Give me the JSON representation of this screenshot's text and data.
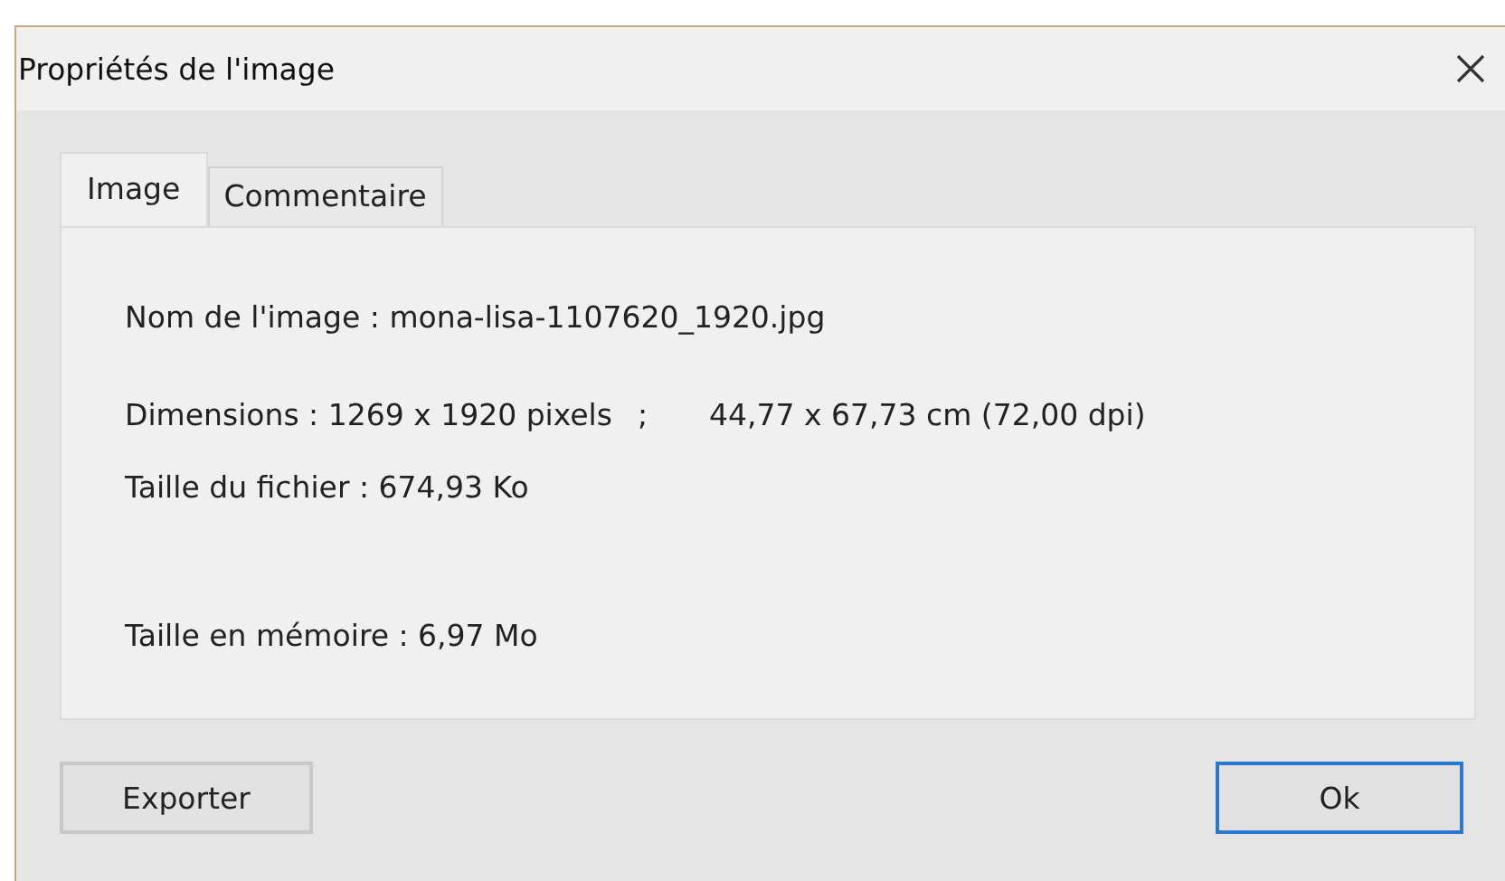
{
  "window": {
    "title": "Propriétés de l'image"
  },
  "tabs": [
    {
      "label": "Image",
      "selected": true
    },
    {
      "label": "Commentaire",
      "selected": false
    }
  ],
  "info_lines": [
    {
      "texts": [
        "Nom de l'image : mona-lisa-1107620_1920.jpg"
      ]
    },
    {
      "texts": [
        "Dimensions : 1269 x 1920 pixels",
        ";",
        "44,77 x 67,73 cm  (72,00 dpi)"
      ]
    },
    {
      "texts": [
        "Taille du fichier : 674,93 Ko"
      ]
    },
    {
      "texts": [
        "Taille en mémoire : 6,97 Mo"
      ]
    }
  ],
  "buttons": [
    {
      "label": "Exporter",
      "default": false
    },
    {
      "label": "Ok",
      "default": true
    }
  ]
}
